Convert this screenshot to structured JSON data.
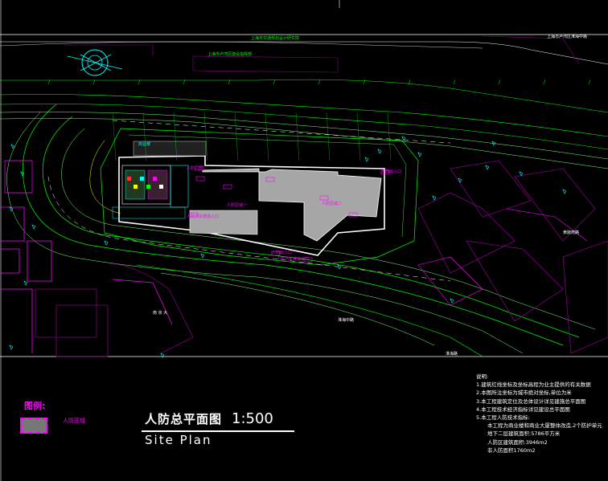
{
  "drawing": {
    "legend": {
      "title": "图例:",
      "item_label": "人防区域"
    },
    "title_cn": "人防总平面图",
    "scale": "1:500",
    "title_en": "Site Plan"
  },
  "notes": {
    "heading": "说明:",
    "lines": [
      "1.建筑红线坐标及坐标高程为业主提供的有关数据",
      "2.本图所注坐标为城市绝对坐标,单位为米",
      "3.本工程建筑定位及总体设计详见建施总平面图",
      "4.本工程技术经济指标详见建设总平面图",
      "5.本工程人防技术指标:"
    ],
    "sub_lines": [
      "本工程为商业楼和商业大厦整体改造,2个防护单元",
      "地下二层建筑面积:5786平方米",
      "人防区建筑面积:3946m2",
      "非人防面积1760m2"
    ]
  },
  "map_labels": [
    {
      "text": "上海市卢湾区建设指挥部",
      "color": "#00ff00"
    },
    {
      "text": "上海市交通规划设计研究院",
      "color": "#00ff00"
    },
    {
      "text": "上海市卢湾区淮海中路",
      "color": "#ffffff"
    },
    {
      "text": "人防口部",
      "color": "#ff00ff"
    },
    {
      "text": "人防出入口",
      "color": "#ff00ff"
    },
    {
      "text": "人防出入口",
      "color": "#ff00ff"
    },
    {
      "text": "淮海中路",
      "color": "#ffffff"
    },
    {
      "text": "南 京 大",
      "color": "#ffffff"
    },
    {
      "text": "人防汽车坡道入口",
      "color": "#ff00ff"
    },
    {
      "text": "人防汽车坡道出口",
      "color": "#ff00ff"
    },
    {
      "text": "人防区域一",
      "color": "#ff00ff"
    },
    {
      "text": "人防区域二",
      "color": "#ff00ff"
    },
    {
      "text": "商业楼",
      "color": "#00ffff"
    },
    {
      "text": "淮海路",
      "color": "#ffffff"
    },
    {
      "text": "黄陂南路",
      "color": "#ffffff"
    }
  ],
  "colors": {
    "background": "#000000",
    "road_green": "#00ff00",
    "road_lightgreen": "#7fff7f",
    "building_magenta": "#ff00ff",
    "bldg_dark": "#7f007f",
    "cyan": "#00ffff",
    "civil_defense_fill": "#a6a6a6",
    "white": "#ffffff",
    "yellow": "#ffff00",
    "red": "#ff3333"
  }
}
